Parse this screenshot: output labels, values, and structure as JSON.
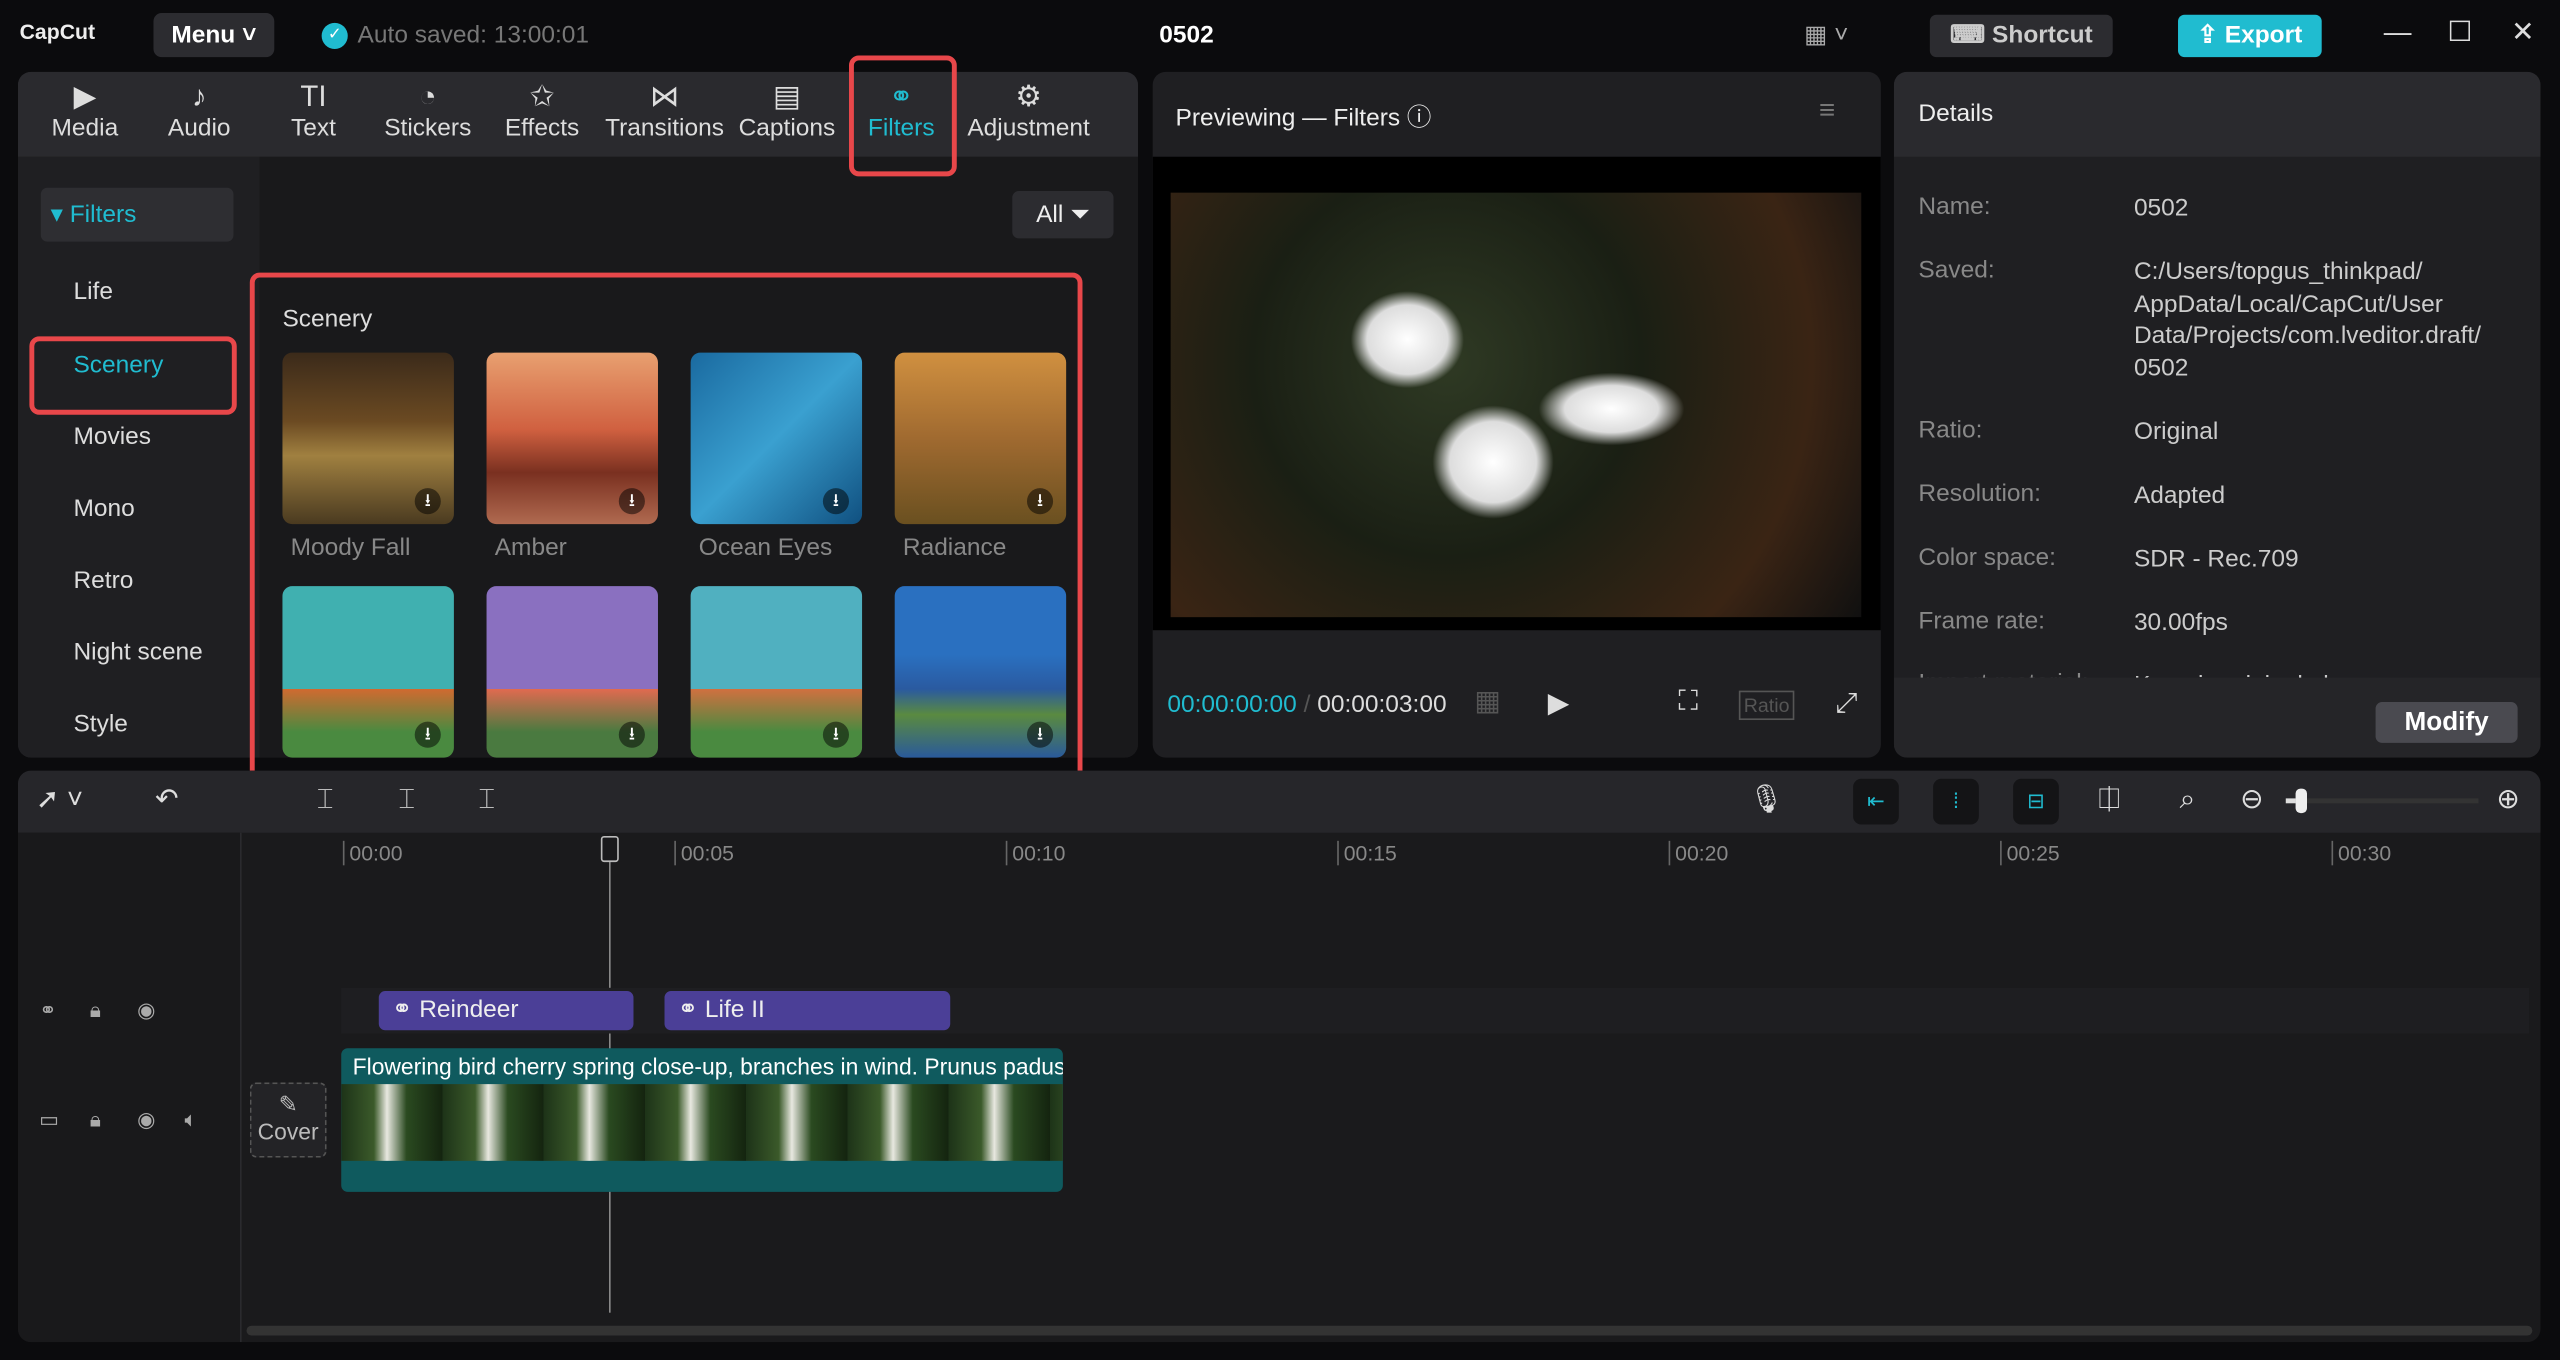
{
  "app": {
    "logo": "CapCut",
    "menu": "Menu",
    "auto_saved": "Auto saved: 13:00:01",
    "project_title": "0502",
    "shortcut": "Shortcut",
    "export": "Export"
  },
  "toolbar": {
    "tabs": [
      {
        "label": "Media",
        "icon": "▶"
      },
      {
        "label": "Audio",
        "icon": "♪"
      },
      {
        "label": "Text",
        "icon": "TI"
      },
      {
        "label": "Stickers",
        "icon": "◔"
      },
      {
        "label": "Effects",
        "icon": "✩"
      },
      {
        "label": "Transitions",
        "icon": "⋈"
      },
      {
        "label": "Captions",
        "icon": "▤"
      },
      {
        "label": "Filters",
        "icon": "⚭"
      },
      {
        "label": "Adjustment",
        "icon": "⚙"
      }
    ],
    "active": "Filters"
  },
  "sidebar": {
    "header": "Filters",
    "items": [
      "Life",
      "Scenery",
      "Movies",
      "Mono",
      "Retro",
      "Night scene",
      "Style"
    ],
    "selected": "Scenery"
  },
  "filters": {
    "all_label": "All",
    "section": "Scenery",
    "items": [
      "Moody Fall",
      "Amber",
      "Ocean Eyes",
      "Radiance",
      "",
      "",
      "",
      ""
    ]
  },
  "preview": {
    "title": "Previewing — Filters",
    "current_time": "00:00:00:00",
    "total_time": "00:00:03:00",
    "ratio": "Ratio"
  },
  "details": {
    "title": "Details",
    "rows": [
      {
        "label": "Name:",
        "value": "0502"
      },
      {
        "label": "Saved:",
        "value": "C:/Users/topgus_thinkpad/ AppData/Local/CapCut/User Data/Projects/com.lveditor.draft/ 0502"
      },
      {
        "label": "Ratio:",
        "value": "Original"
      },
      {
        "label": "Resolution:",
        "value": "Adapted"
      },
      {
        "label": "Color space:",
        "value": "SDR - Rec.709"
      },
      {
        "label": "Frame rate:",
        "value": "30.00fps"
      },
      {
        "label": "Import material:",
        "value": "Keep in original place"
      }
    ],
    "modify": "Modify"
  },
  "timeline": {
    "ticks": [
      "00:00",
      "00:05",
      "00:10",
      "00:15",
      "00:20",
      "00:25",
      "00:30"
    ],
    "filter_clips": [
      "Reindeer",
      "Life II"
    ],
    "video_clip": "Flowering bird cherry spring close-up, branches in wind. Prunus padus",
    "cover": "Cover",
    "zoom_level": 0.05
  }
}
